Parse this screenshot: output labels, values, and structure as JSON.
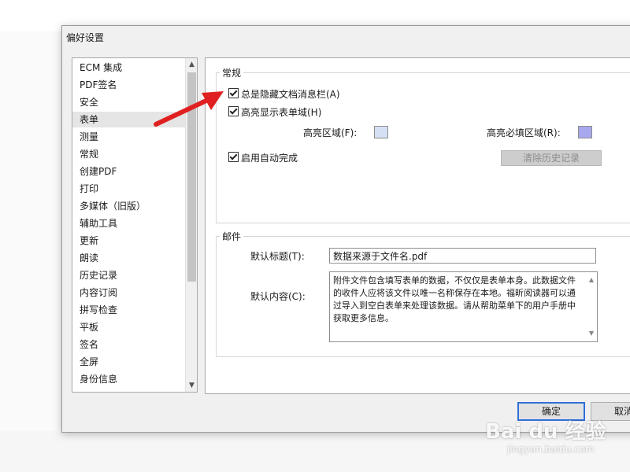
{
  "dialog": {
    "title": "偏好设置"
  },
  "sidebar": {
    "selected_index": 3,
    "items": [
      "ECM 集成",
      "PDF签名",
      "安全",
      "表单",
      "测量",
      "常规",
      "创建PDF",
      "打印",
      "多媒体（旧版）",
      "辅助工具",
      "更新",
      "朗读",
      "历史记录",
      "内容订阅",
      "拼写检查",
      "平板",
      "签名",
      "全屏",
      "身份信息",
      "..."
    ]
  },
  "general": {
    "legend": "常规",
    "hide_doc_bar": {
      "label": "总是隐藏文档消息栏(A)",
      "checked": true
    },
    "highlight_fields": {
      "label": "高亮显示表单域(H)",
      "checked": true
    },
    "highlight_area_label": "高亮区域(F):",
    "highlight_area_color": "#d6e0f5",
    "required_area_label": "高亮必填区域(R):",
    "required_area_color": "#a8a8ee",
    "autocomplete": {
      "label": "启用自动完成",
      "checked": true
    },
    "clear_history_button": "清除历史记录"
  },
  "mail": {
    "legend": "邮件",
    "default_title_label": "默认标题(T):",
    "default_title_value": "数据来源于文件名.pdf",
    "default_content_label": "默认内容(C):",
    "default_content_value": "附件文件包含填写表单的数据，不仅仅是表单本身。此数据文件的收件人应将该文件以唯一名称保存在本地。福昕阅读器可以通过导入到空白表单来处理该数据。请从帮助菜单下的用户手册中获取更多信息。"
  },
  "footer": {
    "ok_button": "确定",
    "cancel_button": "取消"
  },
  "watermark": {
    "brand": "Bai du 经验",
    "url": "jingyan.baidu.com"
  },
  "icons": {
    "scroll_up": "chevron-up-icon",
    "scroll_down": "chevron-down-icon",
    "annotation": "red-arrow-icon"
  },
  "colors": {
    "accent": "#2f6fd8",
    "annotation_arrow": "#e02020"
  }
}
